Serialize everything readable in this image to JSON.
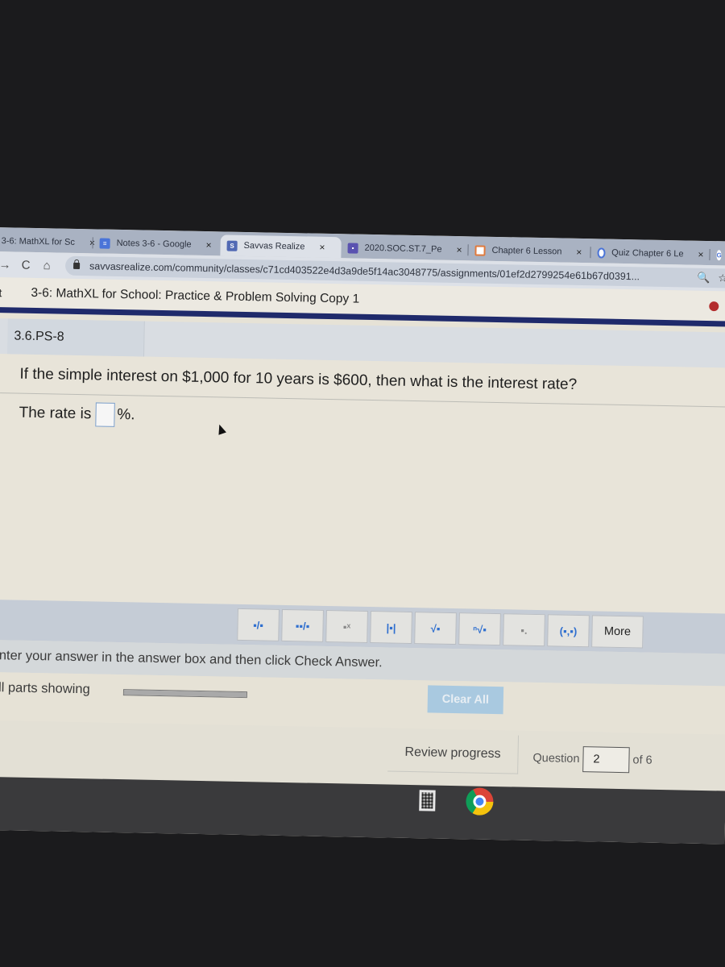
{
  "browser": {
    "tabs": [
      {
        "label": "3-6: MathXL for Sc",
        "icon": "mathxl-icon",
        "active": false
      },
      {
        "label": "Notes 3-6 - Google",
        "icon": "google-docs-icon",
        "active": false
      },
      {
        "label": "Savvas Realize",
        "icon": "savvas-icon",
        "active": true
      },
      {
        "label": "2020.SOC.ST.7_Pe",
        "icon": "classroom-icon",
        "active": false
      },
      {
        "label": "Chapter 6 Lesson",
        "icon": "slides-icon",
        "active": false
      },
      {
        "label": "Quiz Chapter 6 Le",
        "icon": "quiz-icon",
        "active": false
      }
    ],
    "extra_tab_icon": "G",
    "close_glyph": "×",
    "url": "savvasrealize.com/community/classes/c71cd403522e4d3a9de5f14ac3048775/assignments/01ef2d2799254e61b67d0391...",
    "nav": {
      "back": "←",
      "forward": "→",
      "reload": "C",
      "home": "⌂"
    },
    "zoom_glyph": "🔍",
    "star_glyph": "☆"
  },
  "page": {
    "title_prefix": "t",
    "title": "3-6: MathXL for School: Practice & Problem Solving Copy 1",
    "question_id": "3.6.PS-8",
    "question_text": "If the simple interest on $1,000 for 10 years is $600, then what is the interest rate?",
    "answer_prefix": "The rate is",
    "answer_value": "",
    "answer_suffix": "%."
  },
  "palette": {
    "buttons": [
      {
        "name": "fraction-button",
        "glyph": "▪/▪"
      },
      {
        "name": "mixed-number-button",
        "glyph": "▪▪/▪"
      },
      {
        "name": "exponent-button",
        "glyph": "▪ˣ"
      },
      {
        "name": "absolute-value-button",
        "glyph": "|▪|"
      },
      {
        "name": "square-root-button",
        "glyph": "√▪"
      },
      {
        "name": "nth-root-button",
        "glyph": "ⁿ√▪"
      },
      {
        "name": "subscript-button",
        "glyph": "▪."
      },
      {
        "name": "ordered-pair-button",
        "glyph": "(▪,▪)"
      }
    ],
    "more_label": "More"
  },
  "instructions": "Enter your answer in the answer box and then click Check Answer.",
  "parts": {
    "label": "All parts showing",
    "progress_percent": 100
  },
  "clear_all_label": "Clear All",
  "footer": {
    "review_label": "Review progress",
    "question_label": "Question",
    "question_number": "2",
    "of_label": "of 6"
  }
}
